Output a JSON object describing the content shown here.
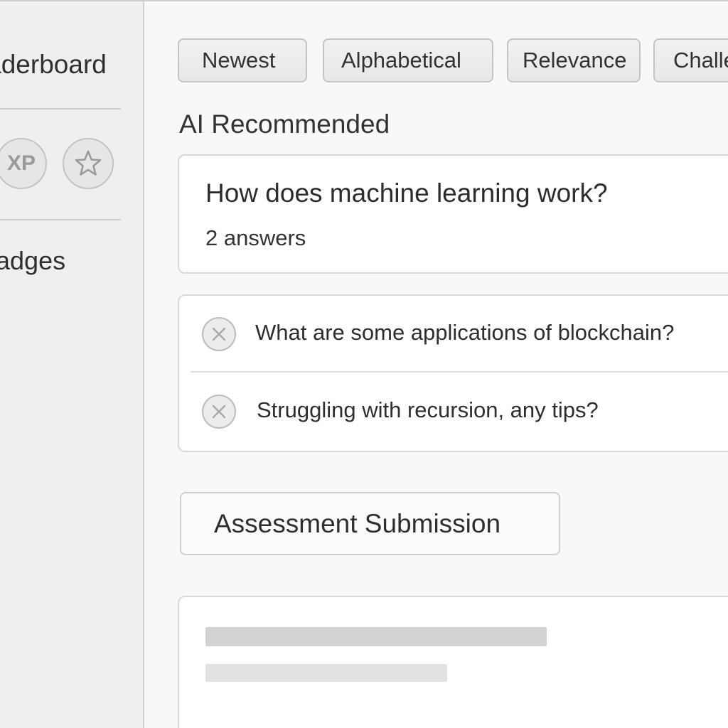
{
  "sidebar": {
    "title": "Leaderboard",
    "icons": [
      {
        "name": "xp-icon",
        "label": "XP"
      },
      {
        "name": "star-icon"
      }
    ],
    "badges_label": "Badges"
  },
  "filters": [
    "Newest",
    "Alphabetical",
    "Relevance",
    "Challenge"
  ],
  "section_title": "AI Recommended",
  "featured_question": {
    "title": "How does machine learning work?",
    "answers": "2 answers"
  },
  "questions": [
    {
      "text": "What are some applications of blockchain?",
      "icon": "close-circle-icon"
    },
    {
      "text": "Struggling with recursion, any tips?",
      "icon": "close-circle-icon"
    }
  ],
  "assessment_button": "Assessment Submission",
  "colors": {
    "background": "#f6f6f6",
    "sidebar": "#efefef",
    "card": "#ffffff",
    "border": "#d9d9d9",
    "skeleton_dark": "#d2d2d2",
    "skeleton_light": "#e2e2e2"
  }
}
